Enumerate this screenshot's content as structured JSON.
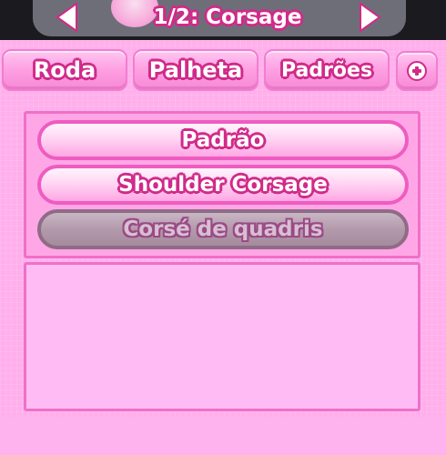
{
  "header": {
    "title": "1/2: Corsage",
    "prev_icon": "arrow-left-icon",
    "next_icon": "arrow-right-icon"
  },
  "tabs": [
    {
      "label": "Roda"
    },
    {
      "label": "Palheta"
    },
    {
      "label": "Padrões"
    },
    {
      "label": "",
      "icon": "plus-icon"
    }
  ],
  "options": [
    {
      "label": "Padrão",
      "state": "active"
    },
    {
      "label": "Shoulder Corsage",
      "state": "active"
    },
    {
      "label": "Corsé de quadris",
      "state": "disabled"
    }
  ],
  "colors": {
    "panel": "#ffafeb",
    "outline": "#d12a8a",
    "header": "#6e6e78",
    "option_border": "#ef5cc1",
    "disabled_option": "#b39aab"
  }
}
